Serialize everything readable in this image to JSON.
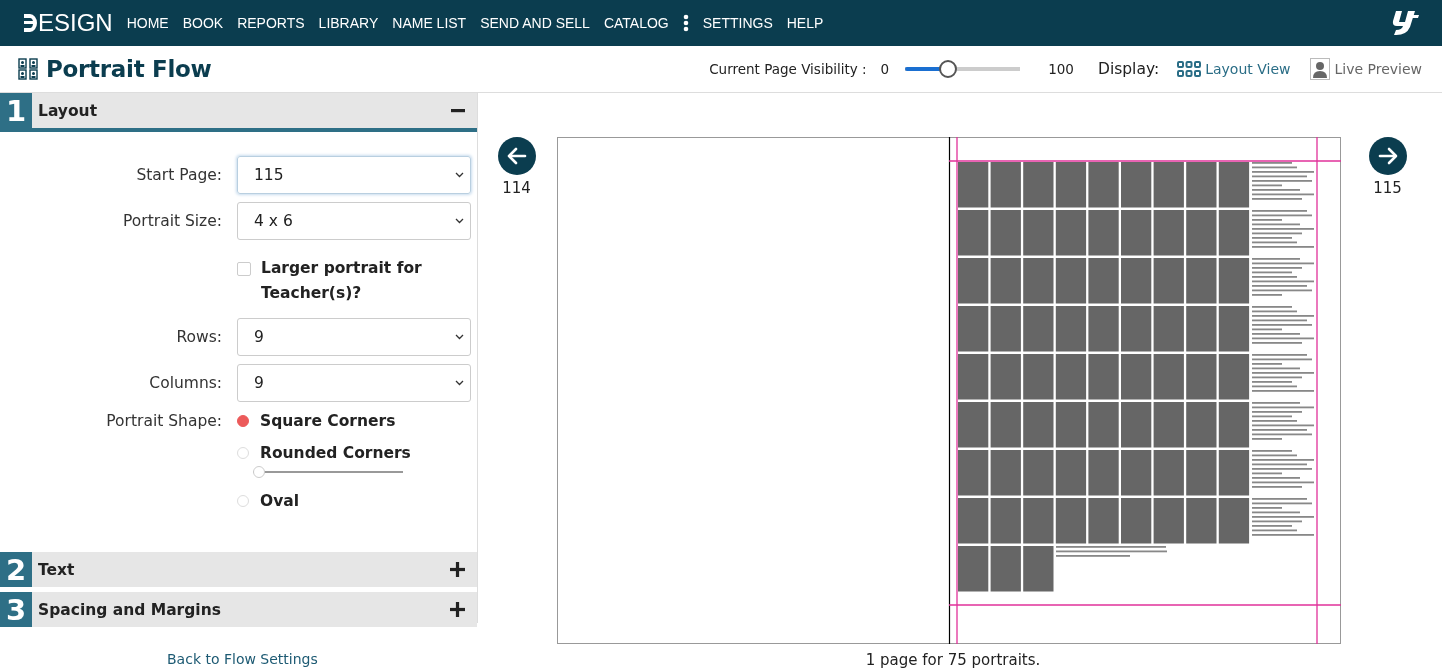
{
  "nav": {
    "logo": "ESIGN",
    "items": [
      {
        "label": "HOME"
      },
      {
        "label": "BOOK"
      },
      {
        "label": "REPORTS"
      },
      {
        "label": "LIBRARY"
      },
      {
        "label": "NAME LIST"
      },
      {
        "label": "SEND AND SELL"
      },
      {
        "label": "CATALOG"
      },
      {
        "kind": "more"
      },
      {
        "label": "SETTINGS"
      },
      {
        "label": "HELP"
      }
    ]
  },
  "header": {
    "title": "Portrait Flow",
    "visibility": {
      "label": "Current Page Visibility :",
      "min": "0",
      "max": "100",
      "level": 0.37
    },
    "display": {
      "label": "Display:",
      "options": [
        {
          "label": "Layout View",
          "selected": true
        },
        {
          "label": "Live Preview",
          "selected": false
        }
      ]
    }
  },
  "sections": [
    {
      "number": "1",
      "title": "Layout",
      "expanded": true,
      "fields": [
        {
          "kind": "select",
          "label": "Start Page:",
          "value": "115",
          "focused": true
        },
        {
          "kind": "select",
          "label": "Portrait Size:",
          "value": "4 x 6",
          "focused": false
        },
        {
          "kind": "checkbox",
          "label": "Larger portrait for Teacher(s)?",
          "checked": false
        },
        {
          "kind": "select",
          "label": "Rows:",
          "value": "9",
          "focused": false
        },
        {
          "kind": "select",
          "label": "Columns:",
          "value": "9",
          "focused": false
        },
        {
          "kind": "radio",
          "label": "Portrait Shape:",
          "options": [
            {
              "label": "Square Corners",
              "selected": true
            },
            {
              "label": "Rounded Corners",
              "selected": false,
              "level": 0
            },
            {
              "label": "Oval",
              "selected": false
            }
          ]
        }
      ]
    },
    {
      "number": "2",
      "title": "Text",
      "expanded": false
    },
    {
      "number": "3",
      "title": "Spacing and Margins",
      "expanded": false
    }
  ],
  "back_link": "Back to Flow Settings",
  "preview": {
    "prev_page": "114",
    "next_page": "115",
    "summary": "1 page for 75 portraits."
  }
}
